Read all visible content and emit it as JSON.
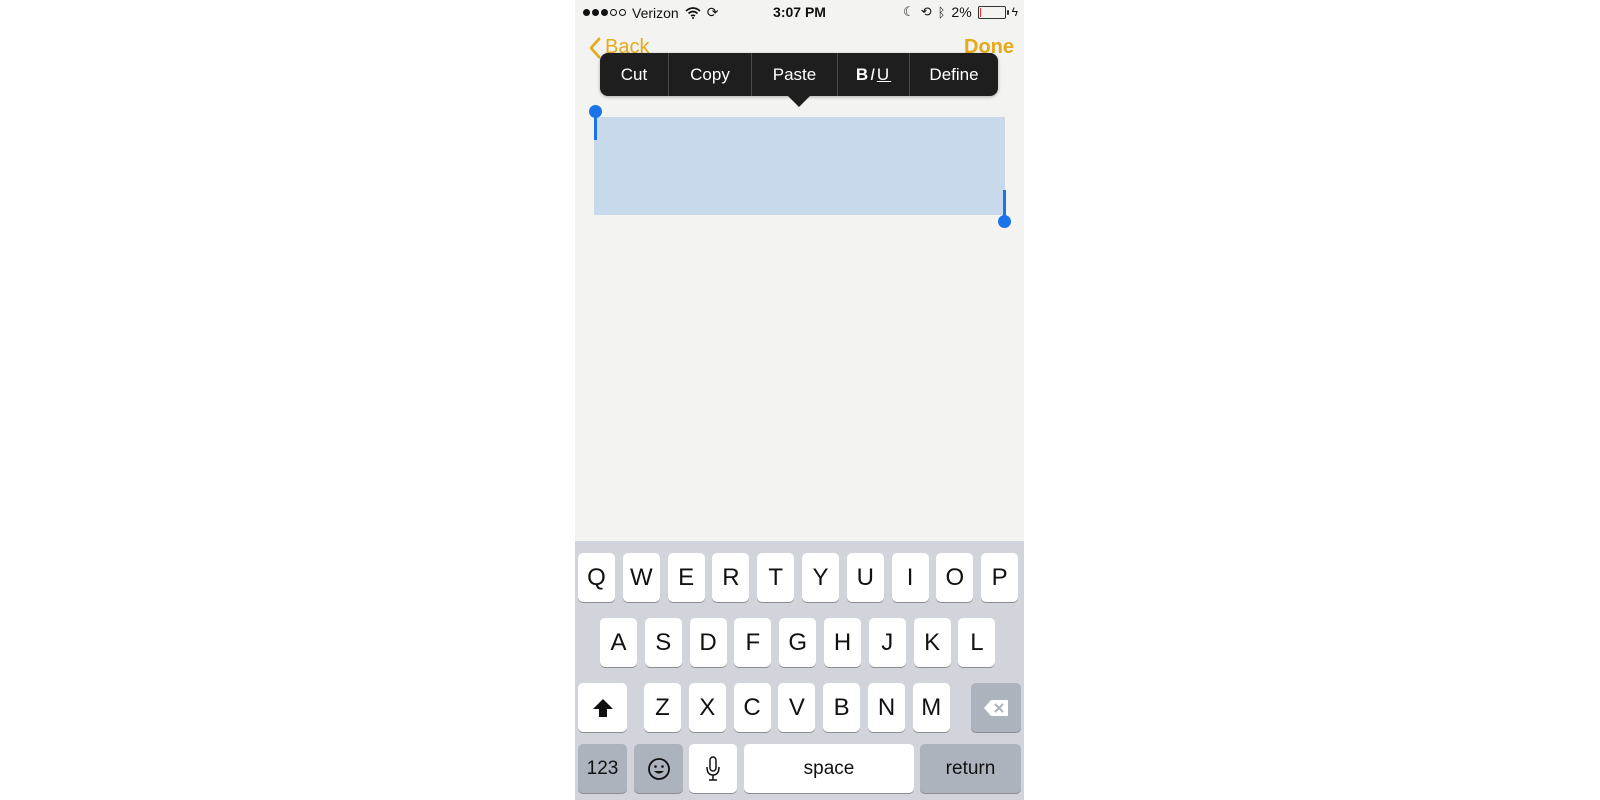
{
  "status_bar": {
    "carrier": "Verizon",
    "time": "3:07 PM",
    "battery_percent": "2%",
    "battery_level": 0.02,
    "signal_bars_filled": 3,
    "signal_bars_total": 5,
    "icons": [
      "wifi-icon",
      "sync-icon",
      "moon-icon",
      "orientation-lock-icon",
      "bluetooth-icon",
      "charging-icon"
    ]
  },
  "nav": {
    "back_label": "Back",
    "done_label": "Done",
    "accent_color": "#e6a919"
  },
  "edit_menu": {
    "items": [
      "Cut",
      "Copy",
      "Paste",
      "BIU",
      "Define"
    ]
  },
  "selection": {
    "color": "#c7d9ea",
    "handle_color": "#1a73e8"
  },
  "keyboard": {
    "row1": [
      "Q",
      "W",
      "E",
      "R",
      "T",
      "Y",
      "U",
      "I",
      "O",
      "P"
    ],
    "row2": [
      "A",
      "S",
      "D",
      "F",
      "G",
      "H",
      "J",
      "K",
      "L"
    ],
    "row3": [
      "Z",
      "X",
      "C",
      "V",
      "B",
      "N",
      "M"
    ],
    "numbers_label": "123",
    "space_label": "space",
    "return_label": "return"
  }
}
